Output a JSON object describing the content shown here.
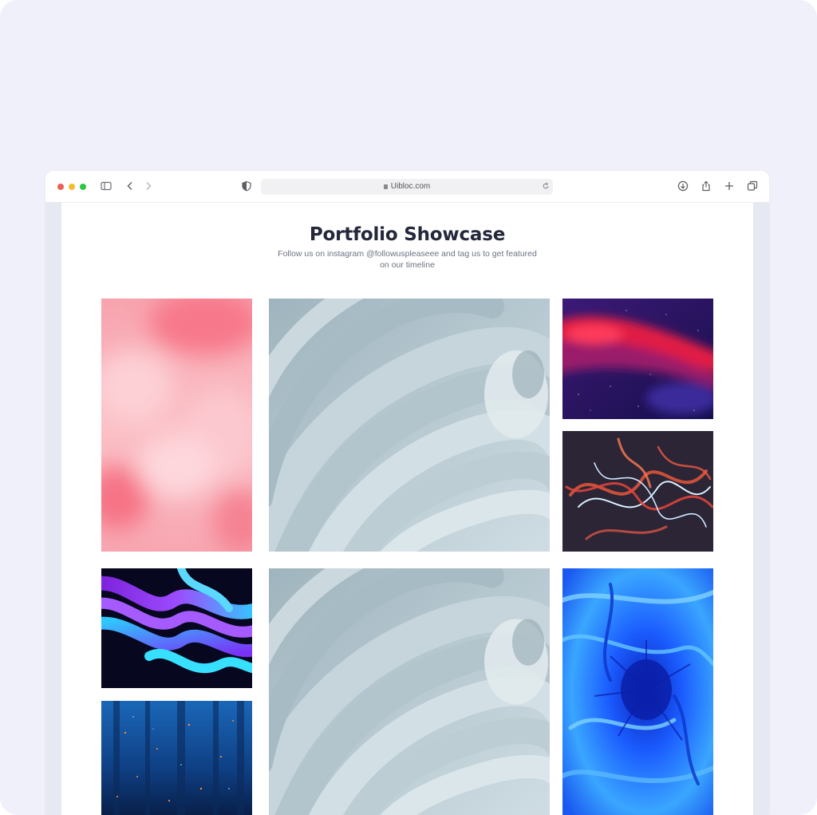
{
  "browser": {
    "url": "Uibloc.com",
    "traffic_lights": [
      "#ee5f57",
      "#f4bc2f",
      "#2bc843"
    ],
    "icons": [
      "sidebar-icon",
      "back-icon",
      "forward-icon",
      "shield-icon",
      "reload-icon",
      "download-icon",
      "share-icon",
      "new-tab-icon",
      "tabs-overview-icon"
    ]
  },
  "page": {
    "title": "Portfolio Showcase",
    "subtitle": "Follow us on instagram @followuspleaseee and tag us to get featured on our timeline"
  },
  "gallery": [
    {
      "name": "pink-clouds",
      "colors": [
        "#f7a8b4",
        "#fbc1c8",
        "#f4808f"
      ]
    },
    {
      "name": "swirl-waves",
      "colors": [
        "#b7c8d0",
        "#d4e0e5",
        "#9aafb9"
      ]
    },
    {
      "name": "red-streak",
      "colors": [
        "#1c1a6b",
        "#e41b43",
        "#6a1f8a"
      ]
    },
    {
      "name": "light-trails",
      "colors": [
        "#2a2538",
        "#f05a44",
        "#d8f0ff"
      ]
    },
    {
      "name": "neon-layers",
      "colors": [
        "#0a0a28",
        "#7b2ff7",
        "#2ec8ff"
      ]
    },
    {
      "name": "swirl-waves-2",
      "colors": [
        "#b7c8d0",
        "#d4e0e5",
        "#9aafb9"
      ]
    },
    {
      "name": "blue-marble",
      "colors": [
        "#1b6bff",
        "#64c6ff",
        "#0b2fd1"
      ]
    },
    {
      "name": "blue-rain",
      "colors": [
        "#0b2a5c",
        "#2a7fd1",
        "#f08a3c"
      ]
    }
  ]
}
